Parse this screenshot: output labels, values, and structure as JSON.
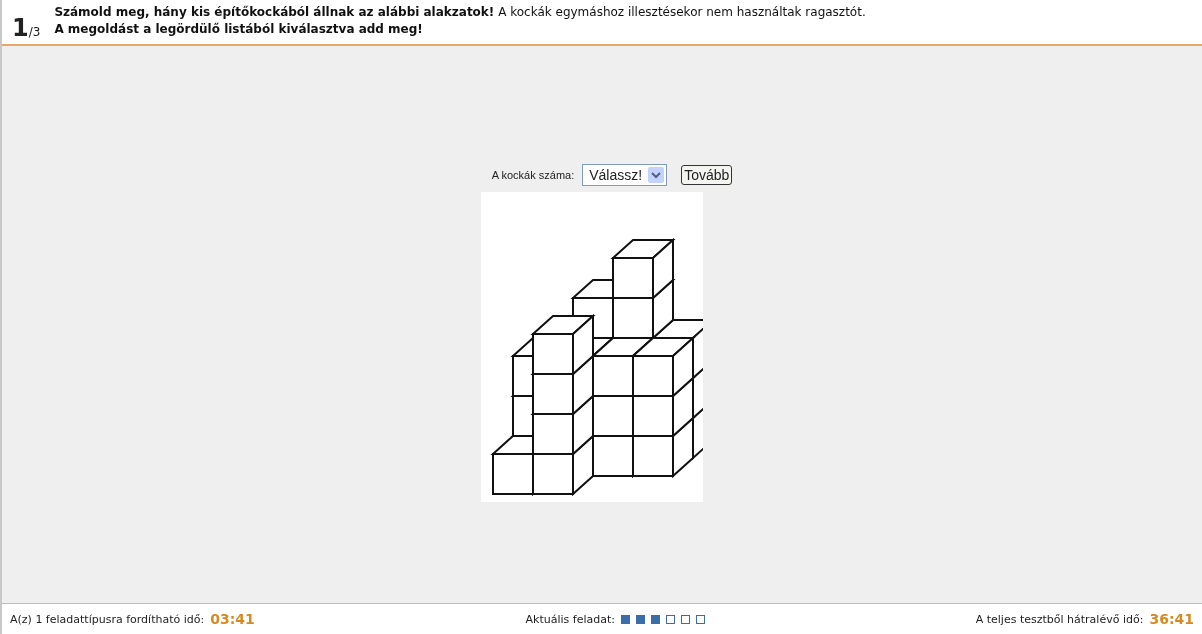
{
  "header": {
    "number": "1",
    "total": "/3",
    "instruction_bold": "Számold meg, hány kis építőkockából állnak az alábbi alakzatok!",
    "instruction": "A kockák egymáshoz illesztésekor nem használtak ragasztót.",
    "instruction_line2": "A megoldást a legördülő listából kiválasztva add meg!"
  },
  "answer": {
    "label": "A kockák száma:",
    "select_value": "Válassz!",
    "button": "Tovább"
  },
  "footer": {
    "type_time_label": "A(z) 1 feladattípusra fordítható idő:",
    "type_time": "03:41",
    "current_label": "Aktuális feladat:",
    "tasks": [
      {
        "filled": true
      },
      {
        "filled": true
      },
      {
        "filled": true
      },
      {
        "filled": false
      },
      {
        "filled": false
      },
      {
        "filled": false
      }
    ],
    "total_time_label": "A teljes tesztből hátralévő idő:",
    "total_time": "36:41"
  }
}
